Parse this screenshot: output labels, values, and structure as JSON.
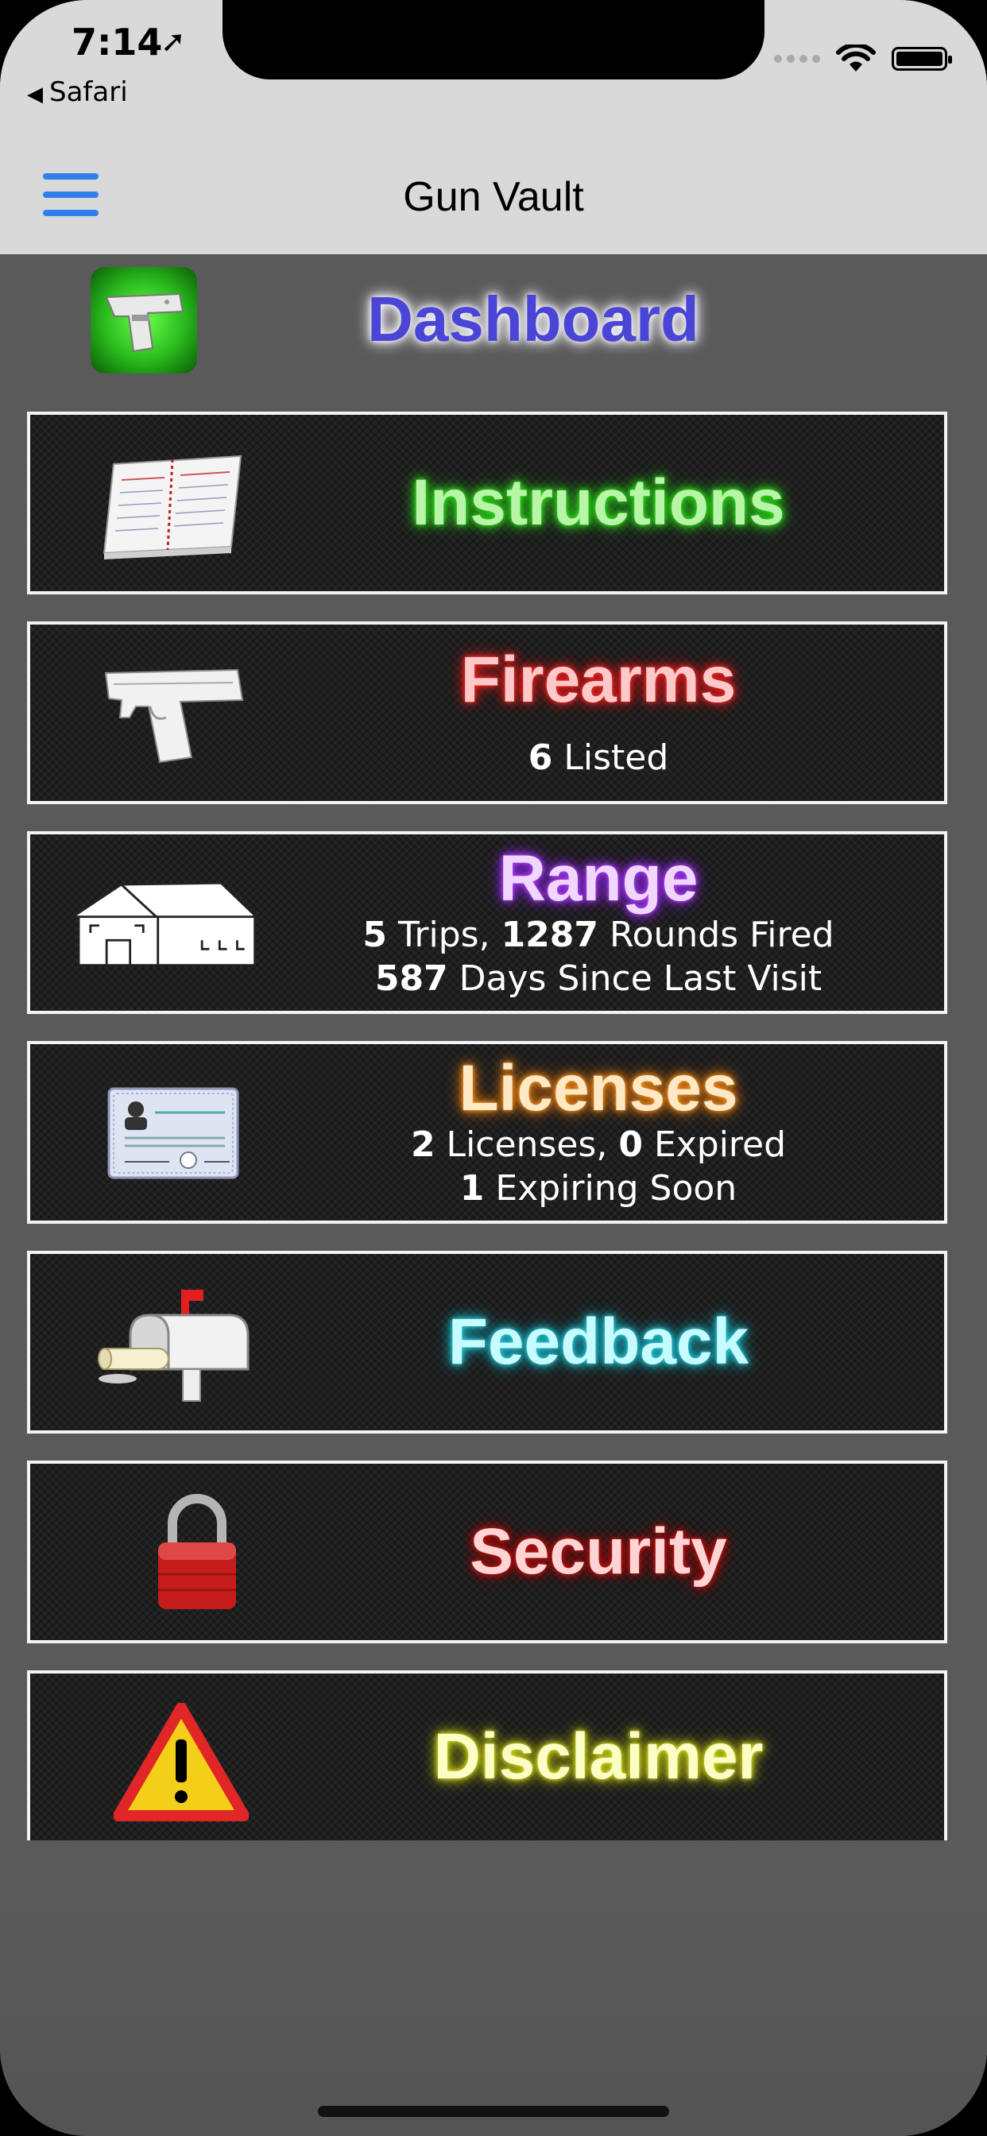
{
  "status_bar": {
    "time": "7:14",
    "location_icon": "location-arrow-icon",
    "back_app": "Safari"
  },
  "nav": {
    "title": "Gun Vault",
    "menu_icon": "hamburger-menu-icon",
    "accent": "#2f80ed"
  },
  "dashboard": {
    "title": "Dashboard",
    "icon": "pistol-icon"
  },
  "menu": [
    {
      "title": "Instructions",
      "icon": "notebook-icon",
      "color": "#31e51d"
    },
    {
      "title": "Firearms",
      "icon": "handgun-icon",
      "color": "#ff3030",
      "line1_num": "6",
      "line1_text": " Listed"
    },
    {
      "title": "Range",
      "icon": "range-building-icon",
      "color": "#b84cff",
      "line1_num_a": "5",
      "line1_text_a": " Trips, ",
      "line1_num_b": "1287",
      "line1_text_b": " Rounds Fired",
      "line2_num": "587",
      "line2_text": " Days Since Last Visit"
    },
    {
      "title": "Licenses",
      "icon": "license-card-icon",
      "color": "#ff9d2a",
      "line1_num_a": "2",
      "line1_text_a": " Licenses, ",
      "line1_num_b": "0",
      "line1_text_b": " Expired",
      "line2_num": "1",
      "line2_text": " Expiring Soon"
    },
    {
      "title": "Feedback",
      "icon": "mailbox-icon",
      "color": "#33d8e8"
    },
    {
      "title": "Security",
      "icon": "padlock-icon",
      "color": "#d21818"
    },
    {
      "title": "Disclaimer",
      "icon": "warning-triangle-icon",
      "color": "#e6ee2a"
    }
  ]
}
